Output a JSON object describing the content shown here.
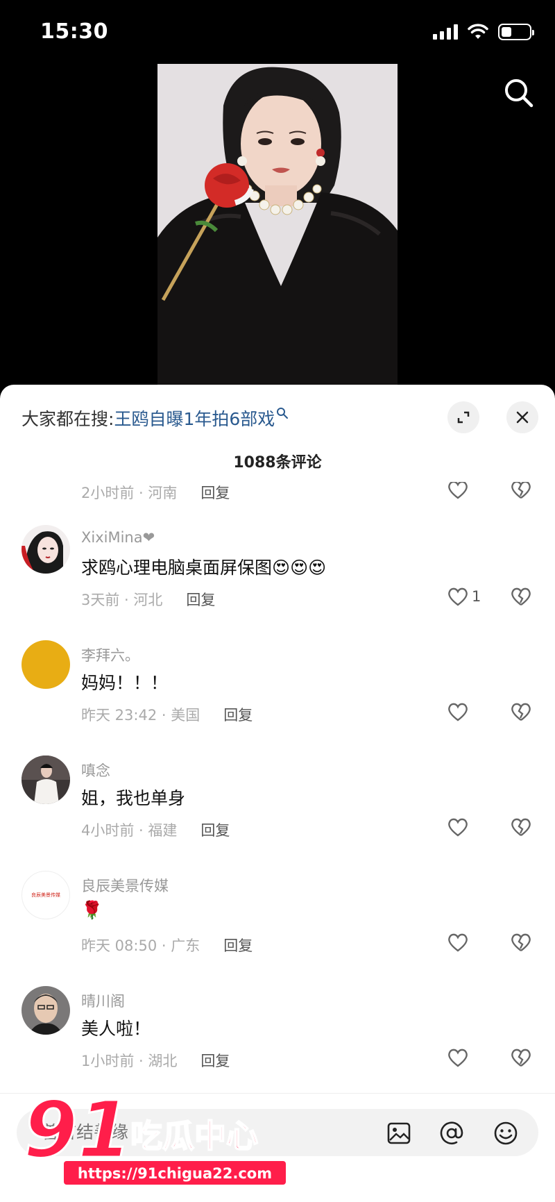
{
  "status_bar": {
    "time": "15:30"
  },
  "sheet": {
    "hot_search_label": "大家都在搜: ",
    "hot_search_term": "王鸥自曝1年拍6部戏",
    "comment_count": "1088条评论"
  },
  "partial_comment": {
    "meta_time": "2小时前 · 河南",
    "reply": "回复"
  },
  "comments": [
    {
      "username": "XixiMina❤",
      "text": "求鸥心理电脑桌面屏保图😍😍😍",
      "time": "3天前 · 河北",
      "reply": "回复",
      "likes": "1"
    },
    {
      "username": "李拜六。",
      "text": "妈妈！！！",
      "time": "昨天 23:42 · 美国",
      "reply": "回复",
      "likes": ""
    },
    {
      "username": "嗔念",
      "text": "姐，我也单身",
      "time": "4小时前 · 福建",
      "reply": "回复",
      "likes": ""
    },
    {
      "username": "良辰美景传媒",
      "text": "🌹",
      "time": "昨天 08:50 · 广东",
      "reply": "回复",
      "likes": ""
    },
    {
      "username": "晴川阁",
      "text": "美人啦！",
      "time": "1小时前 · 湖北",
      "reply": "回复",
      "likes": ""
    }
  ],
  "input_bar": {
    "placeholder": "善言结善缘"
  },
  "watermark": {
    "brand": "91吃瓜中心",
    "url": "https://91chigua22.com"
  },
  "avatar_logo_text": "良辰美景传媒",
  "colors": {
    "hot_search_term": "#2a5a8f",
    "watermark": "#ff1e4a",
    "avatar_yellow": "#e8ad14"
  }
}
